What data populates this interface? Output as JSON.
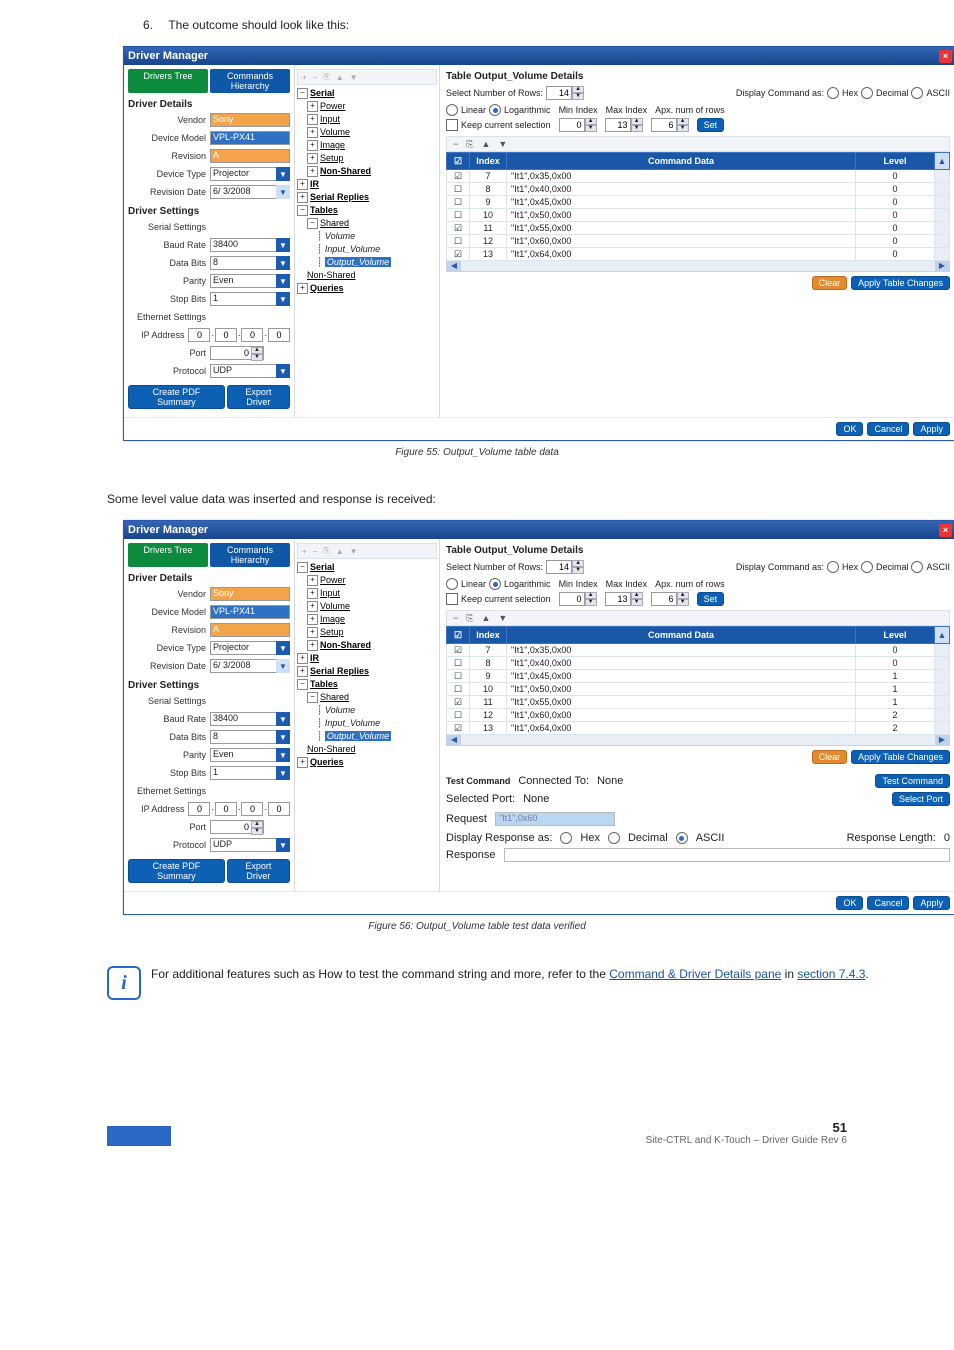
{
  "page": {
    "number": "51",
    "footer_right": "Site-CTRL and K-Touch – Driver Guide Rev 6",
    "step_line_num": "6.",
    "step_line_txt": "The outcome should look like this:"
  },
  "note": {
    "text_prefix": "For additional features such as How to test the command string and more, refer to the ",
    "link": "Command & Driver Details pane",
    "text_mid": " in ",
    "section": "section 7.4.3",
    "text_suffix": "."
  },
  "fig1": {
    "caption": "Figure 55: Output_Volume table data"
  },
  "fig2": {
    "intro": "Some level value data was inserted and response is received:",
    "caption": "Figure 56: Output_Volume table test data verified"
  },
  "dlg_common": {
    "title": "Driver Manager",
    "tabs": {
      "drivers_tree": "Drivers Tree",
      "commands": "Commands Hierarchy"
    },
    "driver_details_label": "Driver Details",
    "vendor_label": "Vendor",
    "vendor_value": "Sony",
    "model_label": "Device Model",
    "model_value": "VPL-PX41",
    "revision_label": "Revision",
    "revision_value": "A",
    "dtype_label": "Device Type",
    "dtype_value": "Projector",
    "revdate_label": "Revision Date",
    "revdate_value": "6/ 3/2008",
    "driver_settings_label": "Driver Settings",
    "serial_label": "Serial Settings",
    "baud_label": "Baud Rate",
    "baud_value": "38400",
    "databits_label": "Data Bits",
    "databits_value": "8",
    "parity_label": "Parity",
    "parity_value": "Even",
    "stopbits_label": "Stop Bits",
    "stopbits_value": "1",
    "eth_label": "Ethernet Settings",
    "ip_label": "IP Address",
    "ip": [
      "0",
      "0",
      "0",
      "0"
    ],
    "port_label": "Port",
    "port_value": "0",
    "protocol_label": "Protocol",
    "protocol_value": "UDP",
    "btn_pdf": "Create PDF Summary",
    "btn_export": "Export Driver",
    "ok": "OK",
    "cancel": "Cancel",
    "apply": "Apply"
  },
  "tree": {
    "serial": "Serial",
    "power": "Power",
    "input": "Input",
    "volume": "Volume",
    "image": "Image",
    "setup": "Setup",
    "nonshared": "Non-Shared",
    "ir": "IR",
    "serial_replies": "Serial Replies",
    "tables": "Tables",
    "shared": "Shared",
    "volume2": "Volume",
    "input_volume": "Input_Volume",
    "output_volume": "Output_Volume",
    "nonshared2": "Non-Shared",
    "queries": "Queries"
  },
  "right1": {
    "title": "Table Output_Volume Details",
    "sel_rows": "Select Number of Rows:",
    "rows_value": "14",
    "display_as": "Display Command as:",
    "hex": "Hex",
    "dec": "Decimal",
    "ascii": "ASCII",
    "linear": "Linear",
    "log": "Logarithmic",
    "min_label": "Min Index",
    "min_value": "0",
    "max_label": "Max Index",
    "max_value": "13",
    "apx_label": "Apx. num of rows",
    "apx_value": "6",
    "set": "Set",
    "keep": "Keep current selection",
    "th_index": "Index",
    "th_cmd": "Command Data",
    "th_level": "Level",
    "rows": [
      {
        "c": "1",
        "i": "7",
        "d": "\"It1\",0x35,0x00",
        "l": "0"
      },
      {
        "c": "0",
        "i": "8",
        "d": "\"It1\",0x40,0x00",
        "l": "0"
      },
      {
        "c": "0",
        "i": "9",
        "d": "\"It1\",0x45,0x00",
        "l": "0"
      },
      {
        "c": "0",
        "i": "10",
        "d": "\"It1\",0x50,0x00",
        "l": "0"
      },
      {
        "c": "1",
        "i": "11",
        "d": "\"It1\",0x55,0x00",
        "l": "0"
      },
      {
        "c": "0",
        "i": "12",
        "d": "\"It1\",0x60,0x00",
        "l": "0"
      },
      {
        "c": "1",
        "i": "13",
        "d": "\"It1\",0x64,0x00",
        "l": "0"
      }
    ],
    "clear": "Clear",
    "apply_table": "Apply Table Changes"
  },
  "right2": {
    "title": "Table Output_Volume Details",
    "sel_rows": "Select Number of Rows:",
    "rows_value": "14",
    "display_as": "Display Command as:",
    "hex": "Hex",
    "dec": "Decimal",
    "ascii": "ASCII",
    "linear": "Linear",
    "log": "Logarithmic",
    "min_label": "Min Index",
    "min_value": "0",
    "max_label": "Max Index",
    "max_value": "13",
    "apx_label": "Apx. num of rows",
    "apx_value": "6",
    "set": "Set",
    "keep": "Keep current selection",
    "th_index": "Index",
    "th_cmd": "Command Data",
    "th_level": "Level",
    "rows": [
      {
        "c": "1",
        "i": "7",
        "d": "\"It1\",0x35,0x00",
        "l": "0"
      },
      {
        "c": "0",
        "i": "8",
        "d": "\"It1\",0x40,0x00",
        "l": "0"
      },
      {
        "c": "0",
        "i": "9",
        "d": "\"It1\",0x45,0x00",
        "l": "1"
      },
      {
        "c": "0",
        "i": "10",
        "d": "\"It1\",0x50,0x00",
        "l": "1"
      },
      {
        "c": "1",
        "i": "11",
        "d": "\"It1\",0x55,0x00",
        "l": "1"
      },
      {
        "c": "0",
        "i": "12",
        "d": "\"It1\",0x60,0x00",
        "l": "2"
      },
      {
        "c": "1",
        "i": "13",
        "d": "\"It1\",0x64,0x00",
        "l": "2"
      }
    ],
    "clear": "Clear",
    "apply_table": "Apply Table Changes",
    "test_cmd_label": "Test Command",
    "connected_to": "Connected To:",
    "connected_val": "None",
    "test_cmd_btn": "Test Command",
    "sel_port_label": "Selected Port:",
    "sel_port_val": "None",
    "select_port_btn": "Select Port",
    "request_label": "Request",
    "request_value": "\"It1\",0x60",
    "disp_resp_label": "Display Response as:",
    "resp_len_label": "Response Length:",
    "resp_len_val": "0",
    "response_label": "Response"
  }
}
